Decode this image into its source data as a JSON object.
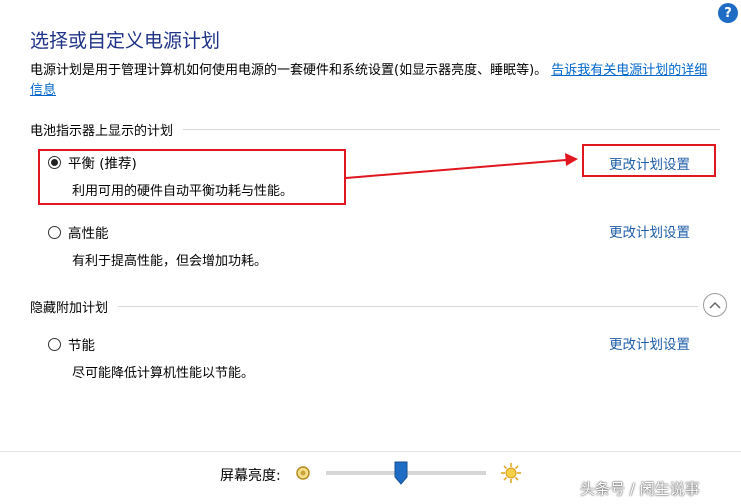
{
  "header": {
    "help_icon_label": "?",
    "title": "选择或自定义电源计划",
    "description": "电源计划是用于管理计算机如何使用电源的一套硬件和系统设置(如显示器亮度、睡眠等)。",
    "description_link": "告诉我有关电源计划的详细信息"
  },
  "battery_section": {
    "heading": "电池指示器上显示的计划",
    "plans": [
      {
        "name": "平衡 (推荐)",
        "desc": "利用可用的硬件自动平衡功耗与性能。",
        "selected": true,
        "change_link": "更改计划设置"
      },
      {
        "name": "高性能",
        "desc": "有利于提高性能，但会增加功耗。",
        "selected": false,
        "change_link": "更改计划设置"
      }
    ]
  },
  "hidden_section": {
    "heading": "隐藏附加计划",
    "plans": [
      {
        "name": "节能",
        "desc": "尽可能降低计算机性能以节能。",
        "selected": false,
        "change_link": "更改计划设置"
      }
    ]
  },
  "footer": {
    "brightness_label": "屏幕亮度:",
    "brightness_level": 0.47
  },
  "watermark": "头条号 / 闲生说事",
  "colors": {
    "title": "#1e3287",
    "link": "#1f5ea8",
    "annotation_red": "#e0171e"
  }
}
